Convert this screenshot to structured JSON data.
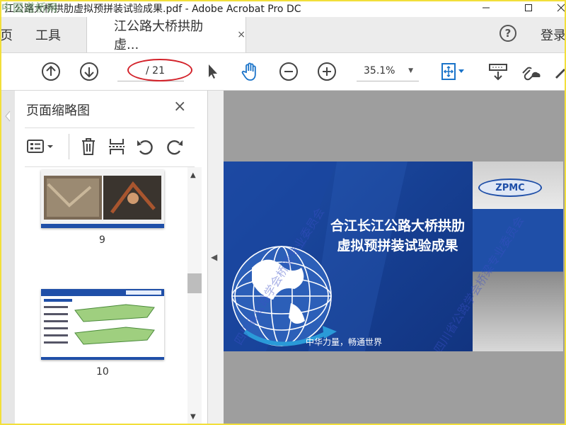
{
  "window": {
    "title": "江公路大桥拱肋虚拟预拼装试验成果.pdf - Adobe Acrobat Pro DC",
    "watermark": "中国道桥网",
    "minimize_icon": "minimize-icon",
    "maximize_icon": "maximize-icon",
    "close_icon": "close-icon"
  },
  "tabs": {
    "home": "页",
    "tools": "工具",
    "document": "江公路大桥拱肋虚...",
    "close": "×",
    "help": "?",
    "login": "登录"
  },
  "toolbar": {
    "current_page": "",
    "total_pages": "/ 21",
    "zoom": "35.1%"
  },
  "panel": {
    "title": "页面缩略图",
    "close": "×",
    "thumbnails": [
      {
        "page": "9"
      },
      {
        "page": "10"
      }
    ]
  },
  "slide": {
    "title_line1": "合江长江公路大桥拱肋",
    "title_line2": "虚拟预拼装试验成果",
    "slogan": "中华力量，畅通世界",
    "logo": "ZPMC",
    "watermark_1": "四川省公路学会桥梁专业委员会",
    "watermark_2": "四川省公路学会桥梁专业委员会"
  },
  "colors": {
    "slide_blue": "#1f4fa8",
    "highlight_red": "#d3222a",
    "frame_yellow": "#f2df3a"
  }
}
